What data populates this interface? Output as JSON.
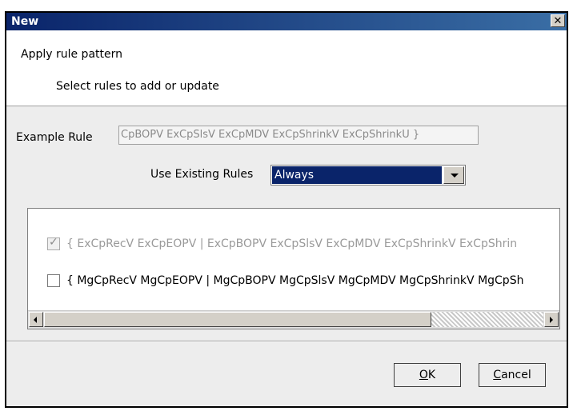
{
  "window": {
    "title": "New",
    "close_label": "✕"
  },
  "header": {
    "title": "Apply rule pattern",
    "subtitle": "Select rules to add or update"
  },
  "example_rule": {
    "label": "Example Rule",
    "value": "CpBOPV ExCpSlsV ExCpMDV ExCpShrinkV ExCpShrinkU }"
  },
  "use_existing": {
    "label": "Use Existing Rules",
    "selected": "Always"
  },
  "rules": [
    {
      "text": "{ ExCpRecV ExCpEOPV | ExCpBOPV ExCpSlsV ExCpMDV ExCpShrinkV ExCpShrin",
      "checked": true,
      "disabled": true
    },
    {
      "text": "{ MgCpRecV MgCpEOPV | MgCpBOPV MgCpSlsV MgCpMDV MgCpShrinkV MgCpSh",
      "checked": false,
      "disabled": false
    }
  ],
  "buttons": {
    "ok_accel": "O",
    "ok_rest": "K",
    "cancel_accel": "C",
    "cancel_rest": "ancel"
  }
}
